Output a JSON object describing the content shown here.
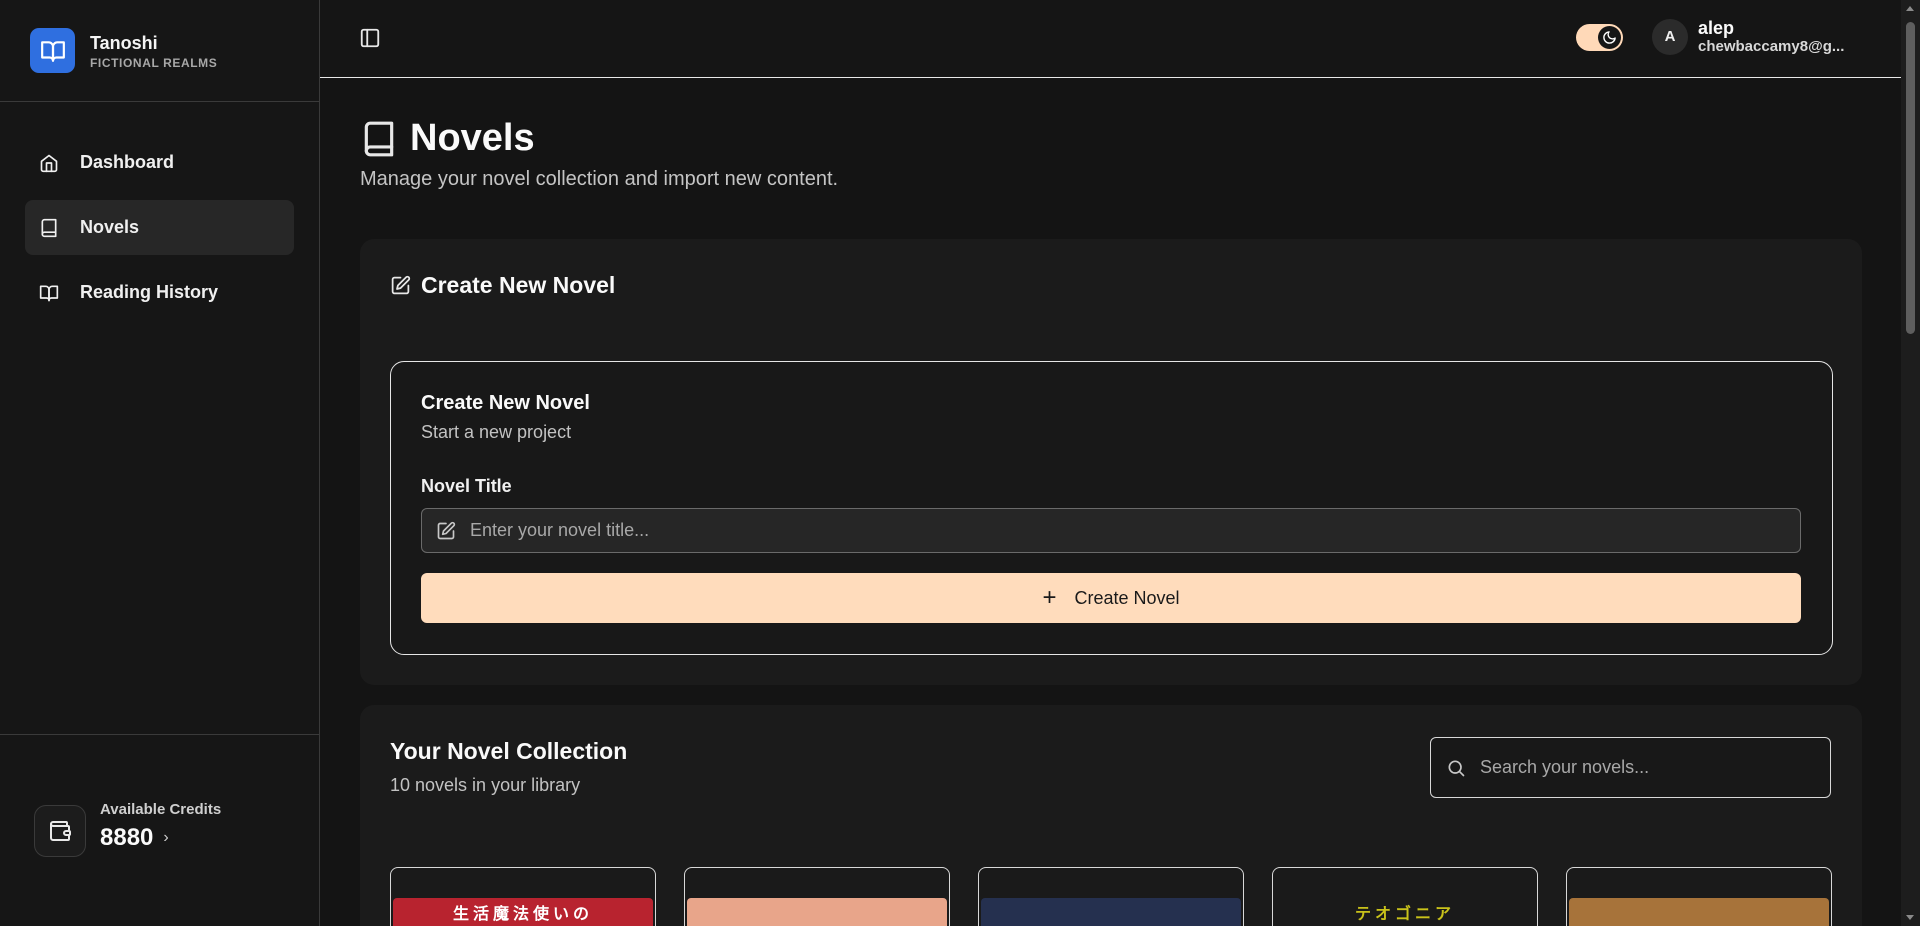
{
  "brand": {
    "name": "Tanoshi",
    "tagline": "FICTIONAL REALMS"
  },
  "sidebar": {
    "items": [
      {
        "label": "Dashboard",
        "icon": "home-icon",
        "active": false
      },
      {
        "label": "Novels",
        "icon": "book-icon",
        "active": true
      },
      {
        "label": "Reading History",
        "icon": "book-open-icon",
        "active": false
      }
    ],
    "credits": {
      "label": "Available Credits",
      "value": "8880"
    }
  },
  "topbar": {
    "theme": "dark",
    "user": {
      "initial": "A",
      "name": "alep",
      "email": "chewbaccamy8@g..."
    }
  },
  "page": {
    "title": "Novels",
    "subtitle": "Manage your novel collection and import new content."
  },
  "create_card": {
    "heading": "Create New Novel",
    "inner_title": "Create New Novel",
    "inner_subtitle": "Start a new project",
    "field_label": "Novel Title",
    "input_value": "",
    "input_placeholder": "Enter your novel title...",
    "button_label": "Create Novel"
  },
  "collection": {
    "title": "Your Novel Collection",
    "subtitle": "10 novels in your library",
    "search_placeholder": "Search your novels...",
    "search_value": "",
    "covers": [
      {
        "art_text": "生活魔法使いの",
        "color": "#b8232f"
      },
      {
        "art_text": "",
        "color": "#e8a58a"
      },
      {
        "art_text": "",
        "color": "#25304f"
      },
      {
        "art_text": "テオゴニア",
        "color": "#c9c21a"
      },
      {
        "art_text": "",
        "color": "#a7733a"
      }
    ]
  },
  "colors": {
    "accent": "#ffdcbc",
    "brand": "#2f6fe0",
    "background": "#141414",
    "card": "#1b1b1b"
  }
}
